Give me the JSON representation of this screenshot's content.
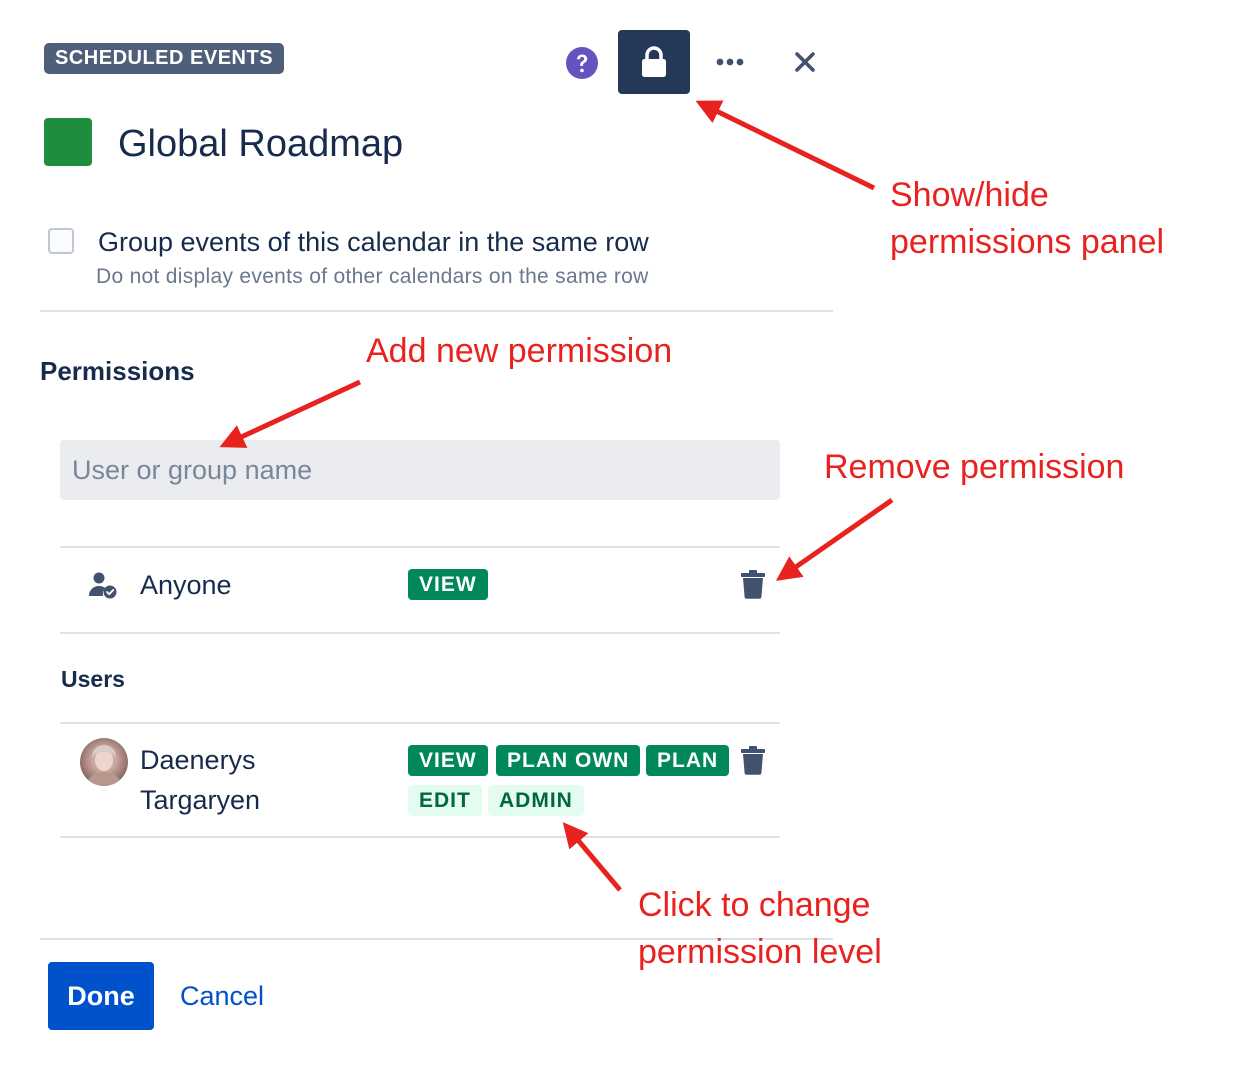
{
  "header": {
    "badge": "SCHEDULED EVENTS",
    "icons": [
      "question-circle-icon",
      "lock-icon",
      "more-icon",
      "close-icon"
    ]
  },
  "calendar": {
    "title": "Global Roadmap",
    "color": "#1e8e3e"
  },
  "grouping": {
    "checked": false,
    "label": "Group events of this calendar in the same row",
    "help": "Do not display events of other calendars on the same row"
  },
  "permissions": {
    "heading": "Permissions",
    "search_placeholder": "User or group name",
    "anyone": {
      "label": "Anyone",
      "levels": [
        {
          "label": "VIEW",
          "active": true
        }
      ]
    },
    "users_heading": "Users",
    "users": [
      {
        "first_name": "Daenerys",
        "last_name": "Targaryen",
        "levels": [
          {
            "label": "VIEW",
            "active": true
          },
          {
            "label": "PLAN OWN",
            "active": true
          },
          {
            "label": "PLAN",
            "active": true
          },
          {
            "label": "EDIT",
            "active": false
          },
          {
            "label": "ADMIN",
            "active": false
          }
        ]
      }
    ]
  },
  "footer": {
    "done": "Done",
    "cancel": "Cancel"
  },
  "annotations": {
    "lock_line1": "Show/hide",
    "lock_line2": "permissions panel",
    "add": "Add new permission",
    "remove": "Remove permission",
    "change_line1": "Click to change",
    "change_line2": "permission level"
  },
  "colors": {
    "primary": "#0052cc",
    "active_badge": "#00875a",
    "inactive_badge": "#e3fcef",
    "annotation": "#e8221e",
    "lock_button": "#253858"
  }
}
